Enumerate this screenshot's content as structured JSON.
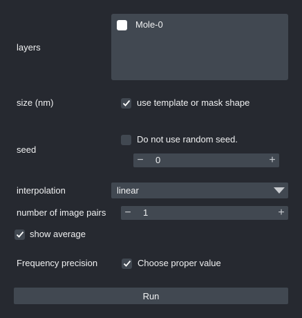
{
  "layers": {
    "label": "layers",
    "items": [
      {
        "label": "Mole-0",
        "checked": false
      }
    ]
  },
  "size": {
    "label": "size (nm)",
    "checkbox_label": "use template or mask shape",
    "checked": true
  },
  "seed": {
    "label": "seed",
    "checkbox_label": "Do not use random seed.",
    "checked": false,
    "value": "0",
    "minus": "−",
    "plus": "+"
  },
  "interpolation": {
    "label": "interpolation",
    "selected": "linear"
  },
  "image_pairs": {
    "label": "number of image pairs",
    "value": "1",
    "minus": "−",
    "plus": "+"
  },
  "show_average": {
    "label": "show average",
    "checked": true
  },
  "frequency_precision": {
    "label": "Frequency precision",
    "checkbox_label": "Choose proper value",
    "checked": true
  },
  "run": {
    "label": "Run"
  },
  "colors": {
    "background": "#262930",
    "widget": "#414851",
    "text": "#f0f1f2"
  }
}
